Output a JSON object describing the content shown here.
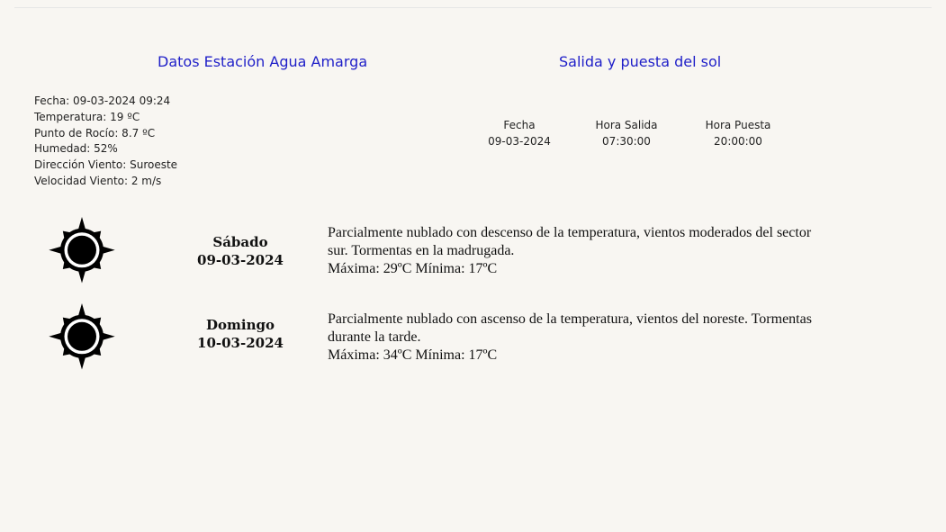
{
  "station": {
    "title": "Datos Estación Agua Amarga",
    "lines": [
      "Fecha: 09-03-2024 09:24",
      "Temperatura: 19 ºC",
      "Punto de Rocío: 8.7 ºC",
      "Humedad: 52%",
      "Dirección Viento: Suroeste",
      "Velocidad Viento: 2 m/s"
    ]
  },
  "sun": {
    "title": "Salida y puesta del sol",
    "headers": [
      "Fecha",
      "Hora Salida",
      "Hora Puesta"
    ],
    "values": [
      "09-03-2024",
      "07:30:00",
      "20:00:00"
    ]
  },
  "forecast": [
    {
      "icon": "sun-icon",
      "day": "Sábado",
      "date": "09-03-2024",
      "description": "Parcialmente nublado con descenso de la temperatura, vientos moderados del sector sur. Tormentas en la madrugada.",
      "temps": "Máxima: 29ºC Mínima: 17ºC"
    },
    {
      "icon": "sun-icon",
      "day": "Domingo",
      "date": "10-03-2024",
      "description": "Parcialmente nublado con ascenso de la temperatura, vientos del noreste. Tormentas durante la tarde.",
      "temps": "Máxima: 34ºC Mínima: 17ºC"
    }
  ],
  "colors": {
    "background": "#f8f6f2",
    "title": "#1f1fc8",
    "icon": "#000000"
  }
}
